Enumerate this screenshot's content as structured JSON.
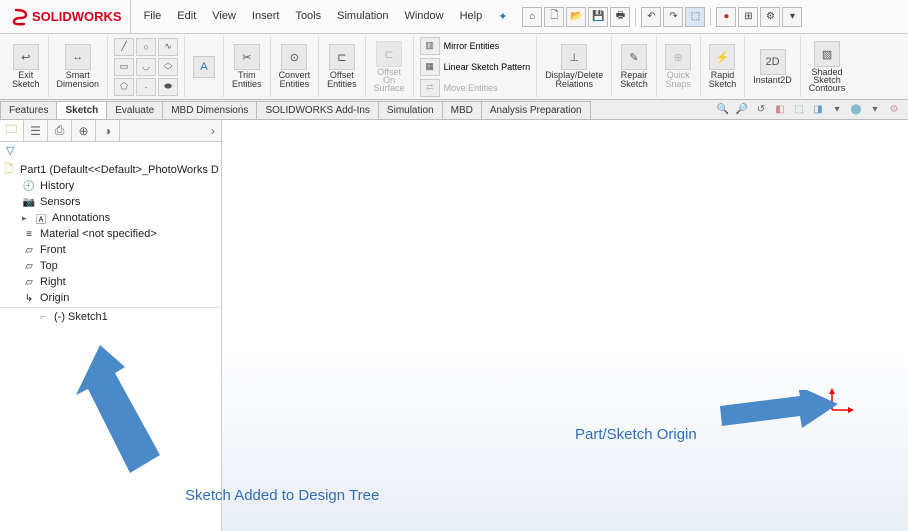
{
  "app": {
    "title": "SOLIDWORKS"
  },
  "menu": {
    "items": [
      "File",
      "Edit",
      "View",
      "Insert",
      "Tools",
      "Simulation",
      "Window",
      "Help"
    ]
  },
  "ribbon": {
    "exit_sketch": "Exit\nSketch",
    "smart_dim": "Smart\nDimension",
    "trim": "Trim\nEntities",
    "convert": "Convert\nEntities",
    "offset": "Offset\nEntities",
    "offset_surface": "Offset\nOn\nSurface",
    "mirror": "Mirror Entities",
    "pattern": "Linear Sketch Pattern",
    "move": "Move Entities",
    "disp_del": "Display/Delete\nRelations",
    "repair": "Repair\nSketch",
    "quick_snaps": "Quick\nSnaps",
    "rapid": "Rapid\nSketch",
    "instant2d": "Instant2D",
    "shaded": "Shaded\nSketch\nContours"
  },
  "tabs": {
    "items": [
      "Features",
      "Sketch",
      "Evaluate",
      "MBD Dimensions",
      "SOLIDWORKS Add-Ins",
      "Simulation",
      "MBD",
      "Analysis Preparation"
    ],
    "active": "Sketch"
  },
  "tree": {
    "root": "Part1  (Default<<Default>_PhotoWorks D",
    "history": "History",
    "sensors": "Sensors",
    "annotations": "Annotations",
    "material": "Material <not specified>",
    "front": "Front",
    "top": "Top",
    "right": "Right",
    "origin": "Origin",
    "sketch1": "(-) Sketch1"
  },
  "annotations": {
    "origin_label": "Part/Sketch Origin",
    "tree_label": "Sketch Added to Design Tree"
  }
}
